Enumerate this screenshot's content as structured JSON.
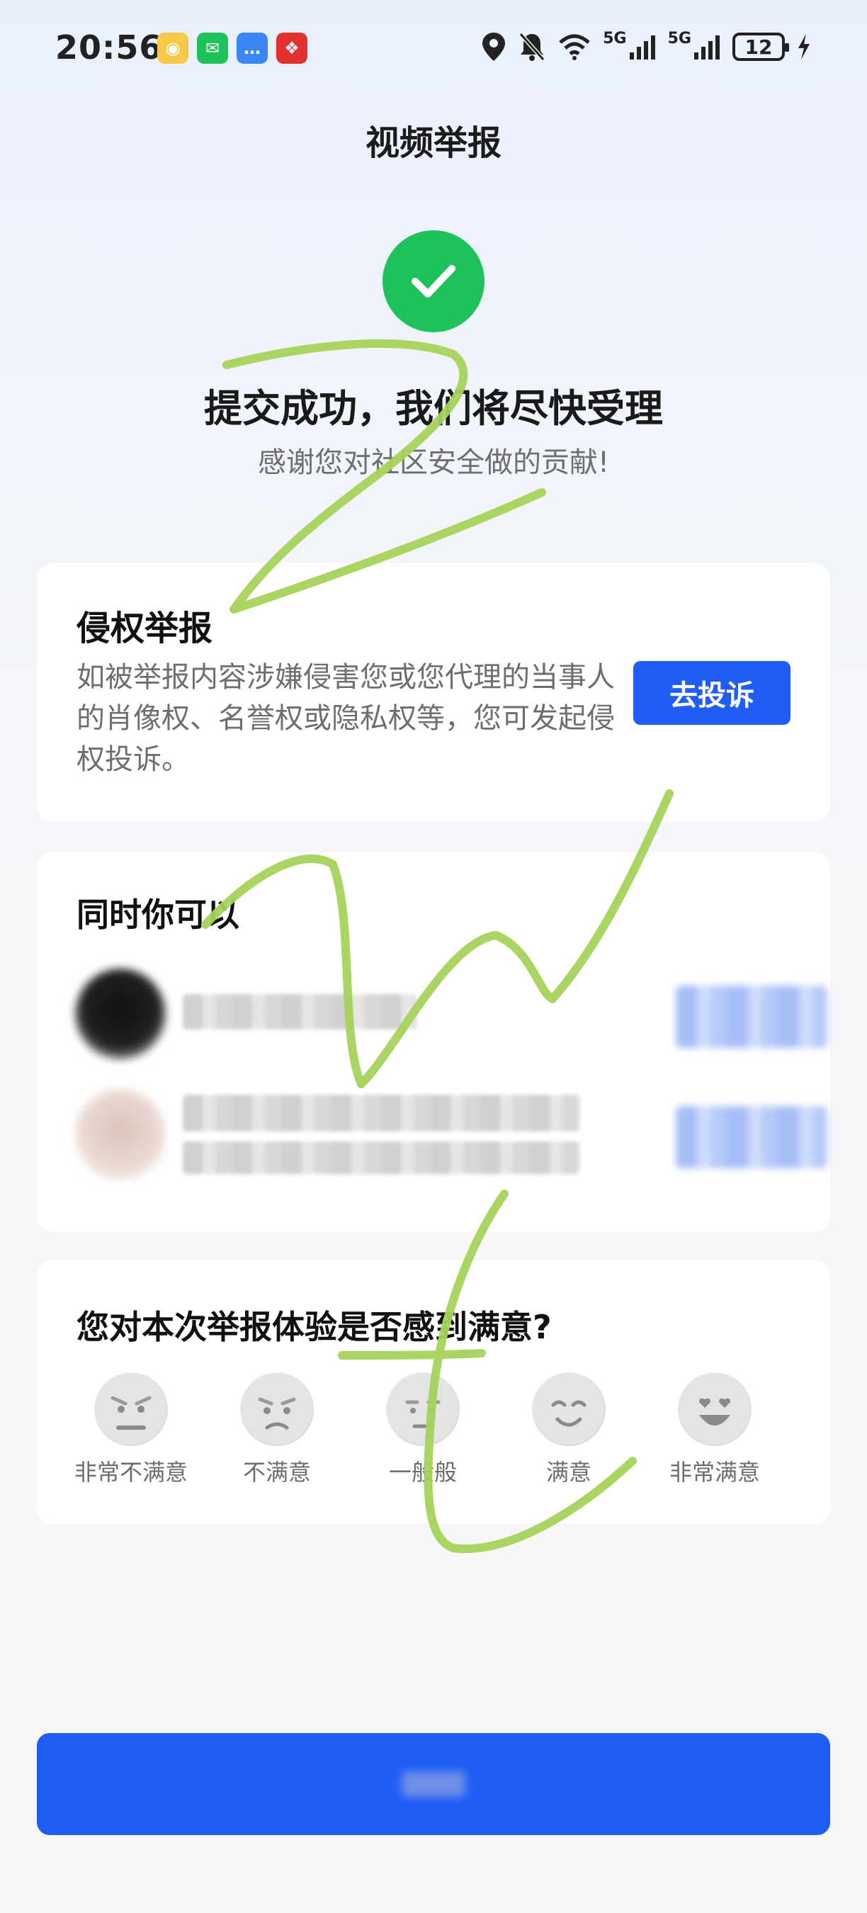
{
  "status_bar": {
    "time": "20:56",
    "network_1": "5G",
    "network_2": "5G",
    "battery": "12"
  },
  "header": {
    "title": "视频举报"
  },
  "success": {
    "title": "提交成功，我们将尽快受理",
    "subtitle": "感谢您对社区安全做的贡献!"
  },
  "rights_card": {
    "title": "侵权举报",
    "description": "如被举报内容涉嫌侵害您或您代理的当事人的肖像权、名誉权或隐私权等，您可发起侵权投诉。",
    "button_label": "去投诉"
  },
  "also_card": {
    "title": "同时你可以"
  },
  "survey": {
    "question": "您对本次举报体验是否感到满意?",
    "options": [
      "非常不满意",
      "不满意",
      "一般般",
      "满意",
      "非常满意"
    ]
  },
  "colors": {
    "primary": "#1f5df5",
    "success": "#1fc15a",
    "scribble": "#a6d35a"
  }
}
